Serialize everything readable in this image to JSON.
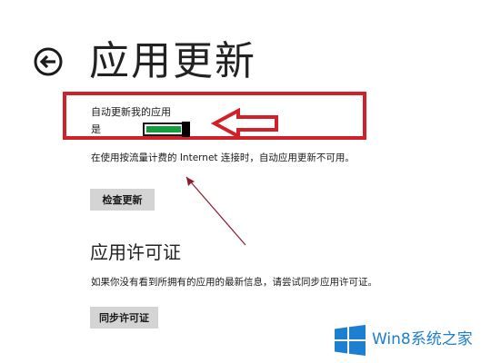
{
  "header": {
    "back_icon": "back-arrow-circle-icon",
    "title": "应用更新"
  },
  "auto_update": {
    "label": "自动更新我的应用",
    "state_label": "是",
    "is_on": true,
    "on_color": "#139e3e",
    "description": "在使用按流量计费的 Internet 连接时，自动应用更新不可用。",
    "check_button_label": "检查更新"
  },
  "licenses": {
    "title": "应用许可证",
    "description": "如果你没有看到所拥有的应用的最新信息，请尝试同步应用许可证。",
    "sync_button_label": "同步许可证"
  },
  "annotations": {
    "highlight_color": "#d2202a",
    "arrow_icon": "outline-arrow-left-icon",
    "pointer_line_color": "#8b1a2b"
  },
  "watermark": {
    "text": "Win8系统之家",
    "logo_icon": "windows-logo-icon",
    "color": "#1d7fd0"
  }
}
